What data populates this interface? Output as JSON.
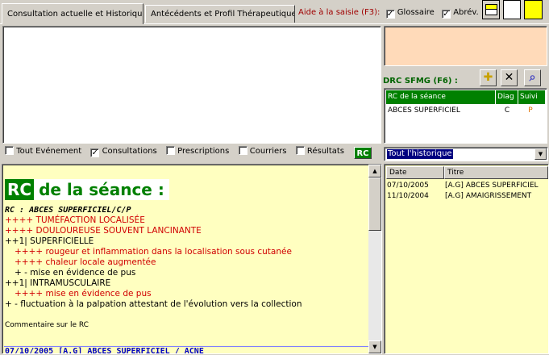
{
  "tabs": [
    {
      "label": "Consultation actuelle et Historique",
      "active": true
    },
    {
      "label": "Antécédents et Profil Thérapeutique",
      "active": false
    }
  ],
  "aide": {
    "label": "Aide à la saisie (F3):",
    "glossaire_label": "Glossaire",
    "glossaire_checked": true,
    "abrev_label": "Abrév.",
    "abrev_checked": true
  },
  "filters": [
    {
      "label": "Tout Evénement",
      "checked": false
    },
    {
      "label": "Consultations",
      "checked": true
    },
    {
      "label": "Prescriptions",
      "checked": false
    },
    {
      "label": "Courriers",
      "checked": false
    },
    {
      "label": "Résultats",
      "checked": false
    }
  ],
  "rc_button": "RC",
  "drc": {
    "label": "DRC SFMG (F6) :",
    "columns": [
      "RC de la séance",
      "Diag",
      "Suivi"
    ],
    "rows": [
      {
        "rc": "ABCES SUPERFICIEL",
        "diag": "C",
        "suivi": "P"
      }
    ]
  },
  "history": {
    "filter_value": "Tout l'historique",
    "columns": [
      "Date",
      "Titre"
    ],
    "rows": [
      {
        "date": "07/10/2005",
        "title": "[A.G]  ABCES SUPERFICIEL"
      },
      {
        "date": "11/10/2004",
        "title": "[A.G] AMAIGRISSEMENT"
      }
    ]
  },
  "editor": {
    "badge": "RC",
    "heading": "de la séance :",
    "lines": [
      {
        "text": "RC : ABCES SUPERFICIEL/C/P",
        "style": "ital"
      },
      {
        "text": "++++ TUMÉFACTION LOCALISÉE",
        "style": "red"
      },
      {
        "text": "++++ DOULOUREUSE SOUVENT LANCINANTE",
        "style": "red"
      },
      {
        "text": "++1| SUPERFICIELLE",
        "style": "blk"
      },
      {
        "text": "++++ rougeur et inflammation dans la localisation sous cutanée",
        "style": "red ind"
      },
      {
        "text": "++++ chaleur locale augmentée",
        "style": "red ind"
      },
      {
        "text": "+ - mise en évidence de pus",
        "style": "blk ind"
      },
      {
        "text": "++1| INTRAMUSCULAIRE",
        "style": "blk"
      },
      {
        "text": "++++ mise en évidence de pus",
        "style": "red ind"
      },
      {
        "text": "+ - fluctuation à la palpation attestant de l'évolution vers la collection",
        "style": "blk"
      },
      {
        "text": "",
        "style": "blk"
      },
      {
        "text": "Commentaire sur le RC",
        "style": "blk small"
      }
    ],
    "bottom_entry": "07/10/2005 [A.G]  ABCES SUPERFICIEL / ACNE"
  }
}
